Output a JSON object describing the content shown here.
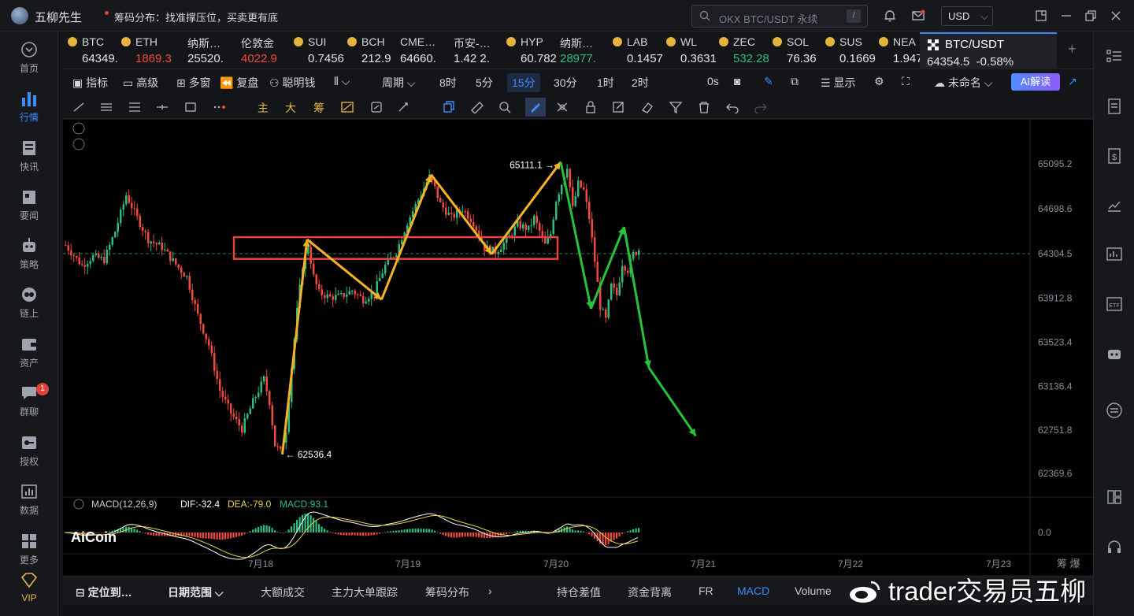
{
  "app": {
    "title": "五柳先生",
    "notice": "筹码分布：找准撑压位，买卖更有底"
  },
  "search": {
    "placeholder": "OKX BTC/USDT 永续",
    "shortcut": "/"
  },
  "currency": {
    "value": "USD",
    "caret": "⌵"
  },
  "left_nav": [
    {
      "label": "首页",
      "icon": "home-icon"
    },
    {
      "label": "行情",
      "icon": "market-icon",
      "active": true
    },
    {
      "label": "快讯",
      "icon": "news-icon"
    },
    {
      "label": "要闻",
      "icon": "headline-icon"
    },
    {
      "label": "策略",
      "icon": "robot-icon"
    },
    {
      "label": "链上",
      "icon": "chain-icon"
    },
    {
      "label": "资产",
      "icon": "wallet-icon"
    },
    {
      "label": "群聊",
      "icon": "chat-icon",
      "badge": "1"
    },
    {
      "label": "授权",
      "icon": "key-icon"
    },
    {
      "label": "数据",
      "icon": "data-icon"
    },
    {
      "label": "更多",
      "icon": "grid-icon"
    },
    {
      "label": "VIP",
      "icon": "vip-icon"
    }
  ],
  "tickers": [
    {
      "name": "BTC",
      "price": "64349.",
      "color": "normal",
      "coin": true
    },
    {
      "name": "ETH",
      "price": "1869.3",
      "color": "red",
      "coin": true
    },
    {
      "name": "纳斯…",
      "price": "25520.",
      "color": "normal",
      "coin": false
    },
    {
      "name": "伦敦金",
      "price": "4022.9",
      "color": "red",
      "coin": false
    },
    {
      "name": "SUI",
      "price": "0.7456",
      "color": "normal",
      "coin": true
    },
    {
      "name": "BCH",
      "price": "212.9",
      "color": "normal",
      "coin": true
    },
    {
      "name": "CME…",
      "price": "64660.",
      "color": "normal",
      "coin": false
    },
    {
      "name": "币安-…",
      "price": "1.42 2.",
      "color": "normal",
      "coin": false
    },
    {
      "name": "HYP",
      "price": "60.782",
      "color": "normal",
      "coin": true
    },
    {
      "name": "纳斯…",
      "price": "28977.",
      "color": "green",
      "coin": false
    },
    {
      "name": "LAB",
      "price": "0.1457",
      "color": "normal",
      "coin": true
    },
    {
      "name": "WL",
      "price": "0.3631",
      "color": "normal",
      "coin": true
    },
    {
      "name": "ZEC",
      "price": "532.28",
      "color": "green",
      "coin": true
    },
    {
      "name": "SOL",
      "price": "76.36",
      "color": "normal",
      "coin": true
    },
    {
      "name": "SUS",
      "price": "0.1669",
      "color": "normal",
      "coin": true
    },
    {
      "name": "NEA",
      "price": "1.947",
      "color": "normal",
      "coin": true
    }
  ],
  "active_ticker": {
    "name": "BTC/USDT",
    "price": "64354.5",
    "change": "-0.58%"
  },
  "toolbar": {
    "indicators": "指标",
    "advanced": "高级",
    "multiwindow": "多窗",
    "replay": "复盘",
    "smart_money": "聪明钱",
    "period": "周期",
    "intervals": [
      "8时",
      "5分",
      "15分",
      "30分",
      "1时",
      "2时"
    ],
    "active_interval": "15分",
    "countdown": "0s",
    "display": "显示",
    "unnamed": "未命名",
    "ai": "AI解读"
  },
  "draw_tools": {
    "main": "主",
    "big": "大",
    "chips": "筹"
  },
  "chart_data": {
    "type": "candlestick",
    "symbol": "BTC/USDT",
    "interval": "15m",
    "yticks": [
      65095.2,
      64698.6,
      64304.5,
      63912.8,
      63523.4,
      63136.4,
      62751.8,
      62369.6
    ],
    "xticks": [
      "7月18",
      "7月19",
      "7月20",
      "7月21",
      "7月22",
      "7月23"
    ],
    "current_price_line": 64304.5,
    "high_label": "65111.1",
    "low_label": "62536.4",
    "price_path": [
      [
        0,
        64380
      ],
      [
        6,
        64200
      ],
      [
        10,
        64280
      ],
      [
        14,
        64250
      ],
      [
        18,
        64500
      ],
      [
        22,
        64820
      ],
      [
        26,
        64620
      ],
      [
        30,
        64430
      ],
      [
        35,
        64360
      ],
      [
        40,
        64210
      ],
      [
        44,
        64100
      ],
      [
        48,
        63760
      ],
      [
        52,
        63500
      ],
      [
        56,
        63100
      ],
      [
        60,
        62900
      ],
      [
        64,
        62760
      ],
      [
        68,
        63000
      ],
      [
        72,
        63200
      ],
      [
        74,
        63000
      ],
      [
        76,
        62620
      ],
      [
        78,
        62560
      ],
      [
        80,
        62760
      ],
      [
        82,
        63300
      ],
      [
        84,
        63800
      ],
      [
        86,
        64200
      ],
      [
        88,
        64380
      ],
      [
        90,
        64100
      ],
      [
        92,
        63960
      ],
      [
        96,
        63920
      ],
      [
        100,
        63930
      ],
      [
        104,
        63980
      ],
      [
        108,
        63900
      ],
      [
        112,
        63970
      ],
      [
        116,
        64200
      ],
      [
        120,
        64320
      ],
      [
        124,
        64580
      ],
      [
        128,
        64780
      ],
      [
        132,
        64980
      ],
      [
        134,
        64880
      ],
      [
        136,
        64740
      ],
      [
        140,
        64620
      ],
      [
        144,
        64700
      ],
      [
        148,
        64580
      ],
      [
        152,
        64360
      ],
      [
        156,
        64320
      ],
      [
        160,
        64420
      ],
      [
        164,
        64560
      ],
      [
        168,
        64520
      ],
      [
        170,
        64620
      ],
      [
        172,
        64500
      ],
      [
        174,
        64380
      ],
      [
        176,
        64480
      ],
      [
        178,
        64780
      ],
      [
        180,
        64920
      ],
      [
        182,
        65080
      ],
      [
        184,
        64700
      ],
      [
        186,
        64920
      ],
      [
        188,
        64860
      ],
      [
        190,
        64620
      ],
      [
        192,
        64240
      ],
      [
        194,
        63840
      ],
      [
        196,
        63720
      ],
      [
        198,
        64020
      ],
      [
        200,
        63940
      ],
      [
        202,
        64220
      ],
      [
        204,
        64160
      ],
      [
        206,
        64300
      ],
      [
        208,
        64340
      ]
    ],
    "macd": {
      "label": "MACD(12,26,9)",
      "dif": "DIF:-32.4",
      "dea": "DEA:-79.0",
      "macd": "MACD:93.1",
      "zero": "0.0"
    },
    "annotations": {
      "yellow_path": [
        [
          79,
          62536.4
        ],
        [
          88,
          64430
        ],
        [
          115,
          63900
        ],
        [
          133,
          65000
        ],
        [
          155,
          64300
        ],
        [
          180,
          65111.1
        ]
      ],
      "green_path": [
        [
          180,
          65111.1
        ],
        [
          191,
          63820
        ],
        [
          203,
          64540
        ],
        [
          212,
          63300
        ],
        [
          229,
          62700
        ]
      ],
      "resistance_box": {
        "from": [
          66,
          64450
        ],
        "to": [
          176,
          64300
        ]
      }
    }
  },
  "logo": {
    "text": "AiCoin"
  },
  "bottom": {
    "locate": "定位到…",
    "date_range": "日期范围",
    "big_trades": "大额成交",
    "main_orders": "主力大单跟踪",
    "chips_dist": "筹码分布",
    "oi_diff": "持仓差值",
    "fund_div": "资金背离",
    "fr": "FR",
    "macd": "MACD",
    "volume": "Volume",
    "more": "筹  爆"
  },
  "watermark": {
    "text": "trader交易员五柳"
  },
  "colors": {
    "accent": "#3d8bff",
    "up": "#2ebd7f",
    "down": "#f0493e",
    "annotation_yellow": "#f5b324",
    "annotation_green": "#27c23a",
    "box": "#e8433a"
  }
}
